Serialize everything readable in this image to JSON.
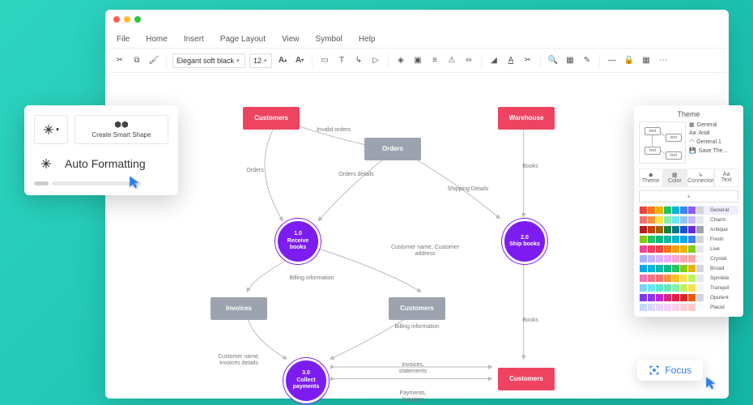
{
  "menu": {
    "items": [
      "File",
      "Home",
      "Insert",
      "Page Layout",
      "View",
      "Symbol",
      "Help"
    ]
  },
  "toolbar": {
    "font": "Elegant soft black",
    "size": "12"
  },
  "smart": {
    "create": "Create Smart Shape",
    "auto": "Auto Formatting"
  },
  "theme": {
    "title": "Theme",
    "opts": [
      "General",
      "Arial",
      "General 1",
      "Save The..."
    ],
    "tabs": [
      "Theme",
      "Color",
      "Connector",
      "Text"
    ],
    "schemes": [
      "General",
      "Charm",
      "Antique",
      "Fresh",
      "Live",
      "Crystal",
      "Broad",
      "Sprinkle",
      "Tranquil",
      "Opulent",
      "Placid"
    ]
  },
  "focus": {
    "label": "Focus"
  },
  "nodes": {
    "customers1": "Customers",
    "warehouse": "Warehouse",
    "orders": "Orders",
    "receive": "1.0\nReceive books",
    "ship": "2.0\nShip books",
    "collect": "3.0\nCollect payments",
    "invoices": "Invoices",
    "customers2": "Customers",
    "customers3": "Customers"
  },
  "labels": {
    "orders": "Orders",
    "invalid": "Invalid orders",
    "ordersdet": "Orders details",
    "shipdet": "Shipping Details",
    "books1": "Books",
    "books2": "Books",
    "custaddr": "Customer name, Customer address",
    "billing1": "Billing information",
    "billing2": "Billing information",
    "custinv": "Customer name, Invoices details",
    "invstmt": "Invoices, statements",
    "payinq": "Payments, Inquiries"
  },
  "colors": {
    "schemes": [
      [
        "#ef4444",
        "#f97316",
        "#eab308",
        "#22c55e",
        "#06b6d4",
        "#3b82f6",
        "#8b5cf6",
        "#d1d5db"
      ],
      [
        "#f87171",
        "#fb923c",
        "#fde047",
        "#86efac",
        "#67e8f9",
        "#93c5fd",
        "#c4b5fd",
        "#e5e7eb"
      ],
      [
        "#b91c1c",
        "#c2410c",
        "#a16207",
        "#15803d",
        "#0e7490",
        "#1d4ed8",
        "#6d28d9",
        "#9ca3af"
      ],
      [
        "#84cc16",
        "#22c55e",
        "#10b981",
        "#14b8a6",
        "#06b6d4",
        "#0ea5e9",
        "#3b82f6",
        "#d1d5db"
      ],
      [
        "#ec4899",
        "#f43f5e",
        "#ef4444",
        "#f97316",
        "#f59e0b",
        "#eab308",
        "#84cc16",
        "#e5e7eb"
      ],
      [
        "#a5b4fc",
        "#c4b5fd",
        "#d8b4fe",
        "#f0abfc",
        "#f9a8d4",
        "#fda4af",
        "#fca5a5",
        "#f3f4f6"
      ],
      [
        "#0ea5e9",
        "#06b6d4",
        "#14b8a6",
        "#10b981",
        "#22c55e",
        "#84cc16",
        "#eab308",
        "#d1d5db"
      ],
      [
        "#f472b6",
        "#fb7185",
        "#f87171",
        "#fb923c",
        "#fbbf24",
        "#fde047",
        "#bef264",
        "#e5e7eb"
      ],
      [
        "#7dd3fc",
        "#67e8f9",
        "#5eead4",
        "#6ee7b7",
        "#86efac",
        "#bef264",
        "#fde047",
        "#f3f4f6"
      ],
      [
        "#7c3aed",
        "#9333ea",
        "#c026d3",
        "#db2777",
        "#e11d48",
        "#dc2626",
        "#ea580c",
        "#d1d5db"
      ],
      [
        "#bfdbfe",
        "#ddd6fe",
        "#e9d5ff",
        "#f5d0fe",
        "#fbcfe8",
        "#fecdd3",
        "#fecaca",
        "#f9fafb"
      ]
    ]
  }
}
